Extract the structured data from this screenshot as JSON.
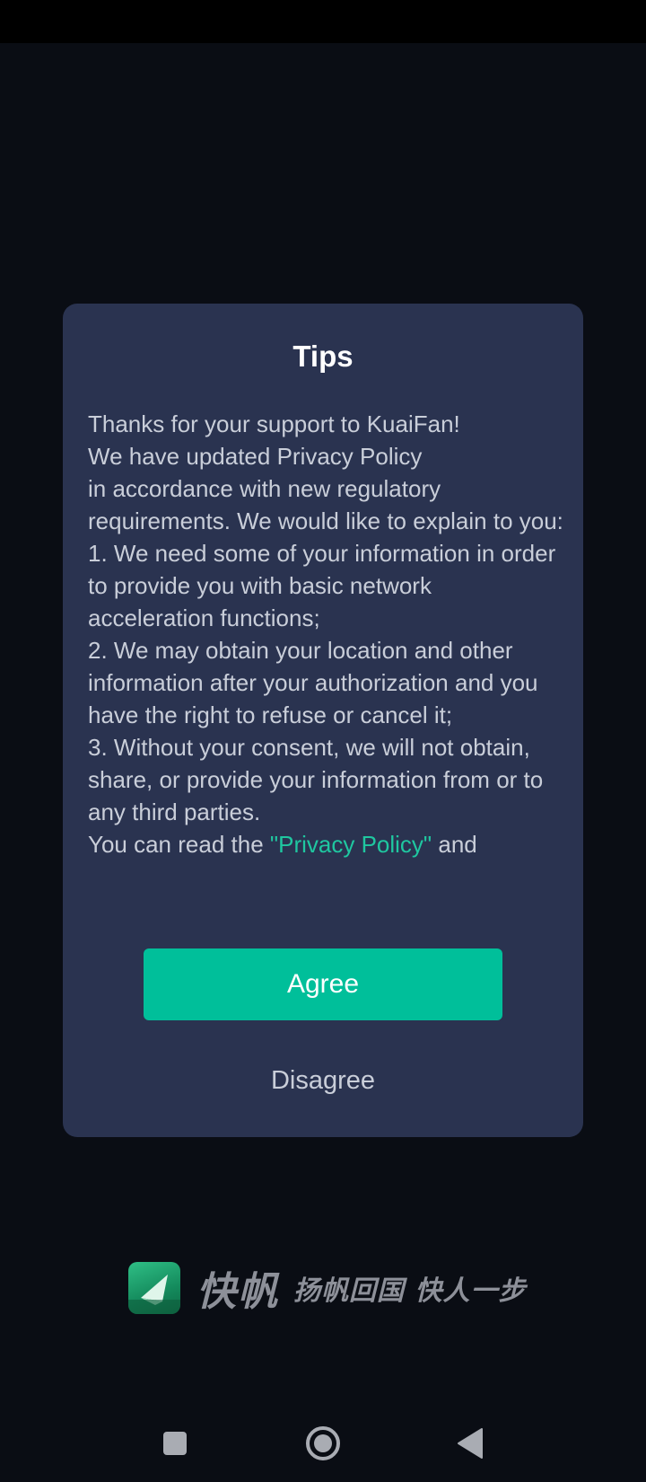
{
  "dialog": {
    "title": "Tips",
    "body": {
      "line1": "Thanks for your support to KuaiFan!",
      "line2": "We have updated Privacy Policy",
      "line3": "in accordance with new regulatory requirements. We would like to explain to you:",
      "item1": "1. We need some of your information in order to provide you with basic network acceleration functions;",
      "item2": "2. We may obtain your location and other information after your authorization and you have the right to refuse or cancel it;",
      "item3": "3. Without your consent, we will not obtain, share, or provide your information from or to any third parties.",
      "read_prefix": "You can read the ",
      "privacy_link": "\"Privacy Policy\"",
      "read_suffix": " and"
    },
    "agree_label": "Agree",
    "disagree_label": "Disagree"
  },
  "brand": {
    "name": "快帆",
    "slogan": "扬帆回国 快人一步"
  },
  "colors": {
    "background": "#0a0d14",
    "dialog": "#2a3350",
    "accent": "#00bf9a",
    "link": "#1fc7a0"
  },
  "nav": {
    "recents_icon": "square-icon",
    "home_icon": "circle-icon",
    "back_icon": "triangle-back-icon"
  }
}
